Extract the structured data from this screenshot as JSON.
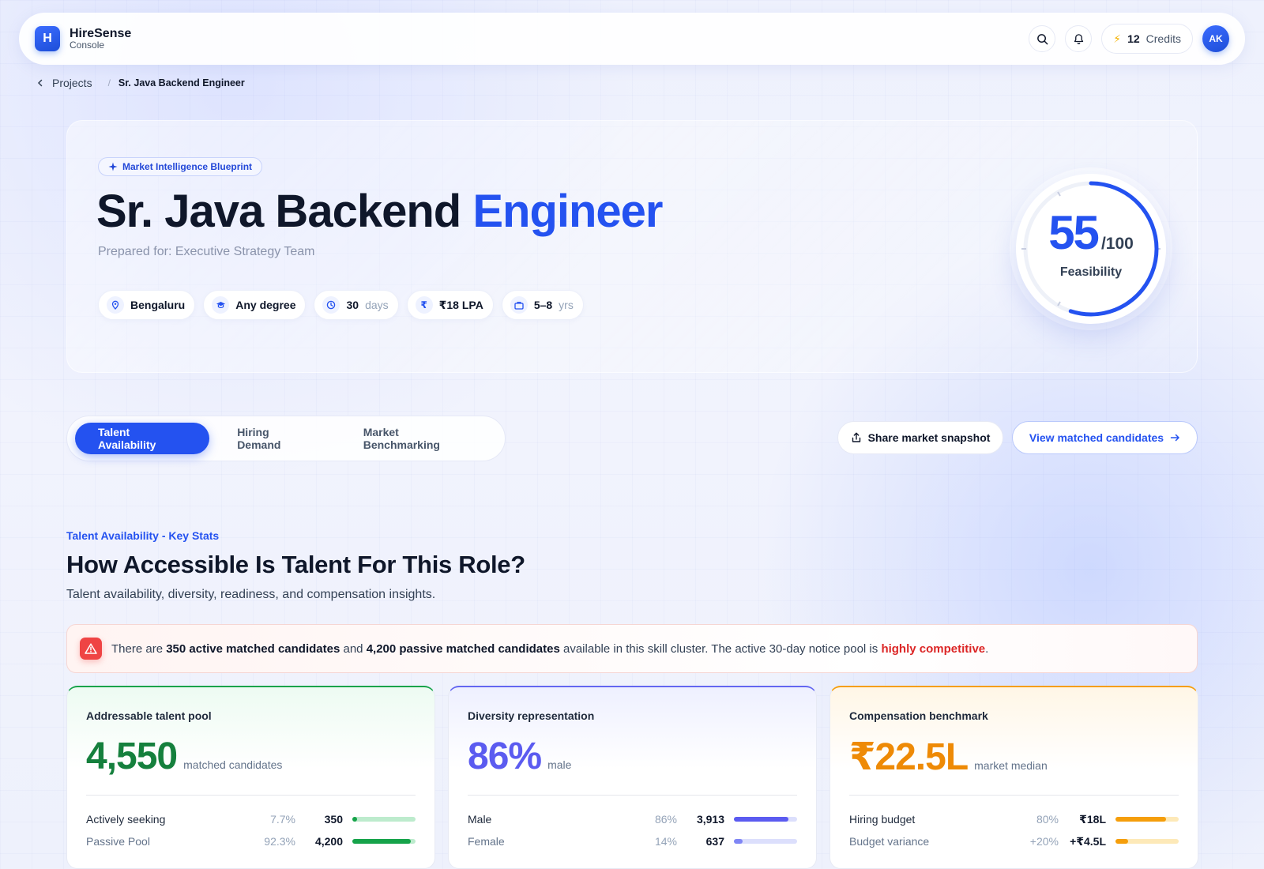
{
  "app": {
    "logo_letter": "H",
    "name": "HireSense",
    "subtitle": "Console",
    "credits_count": "12",
    "credits_label": "Credits",
    "avatar_initials": "AK",
    "icons": {
      "search": "search-icon",
      "bell": "bell-icon",
      "bolt": "bolt-icon"
    }
  },
  "breadcrumb": {
    "back_label": "Projects",
    "separator": "/",
    "current": "Sr. Java Backend Engineer"
  },
  "hero": {
    "badge": "Market Intelligence Blueprint",
    "title_main": "Sr. Java Backend",
    "title_accent": "Engineer",
    "prepared_for": "Prepared for: Executive Strategy Team",
    "chips": [
      {
        "icon": "location-pin-icon",
        "value": "Bengaluru",
        "suffix": ""
      },
      {
        "icon": "graduation-cap-icon",
        "value": "Any degree",
        "suffix": ""
      },
      {
        "icon": "clock-icon",
        "value": "30",
        "suffix": "days"
      },
      {
        "icon": "rupee-icon",
        "value": "₹18 LPA",
        "suffix": ""
      },
      {
        "icon": "briefcase-icon",
        "value": "5–8",
        "suffix": "yrs"
      }
    ],
    "feasibility": {
      "score": "55",
      "out_of": "/100",
      "label": "Feasibility",
      "fraction": 0.55
    }
  },
  "tabs": {
    "items": [
      "Talent Availability",
      "Hiring Demand",
      "Market Benchmarking"
    ],
    "active_index": 0
  },
  "actions": {
    "share": "Share market snapshot",
    "view": "View matched candidates"
  },
  "section": {
    "kicker": "Talent Availability - Key Stats",
    "title": "How Accessible Is Talent For This Role?",
    "subtitle": "Talent availability, diversity, readiness, and compensation insights."
  },
  "alert": {
    "t1": "There are ",
    "b1": "350 active matched candidates",
    "t2": " and ",
    "b2": "4,200 passive matched candidates",
    "t3": " available in this skill cluster. The active 30-day notice pool is ",
    "danger": "highly competitive",
    "t4": "."
  },
  "cards": [
    {
      "title": "Addressable talent pool",
      "value": "4,550",
      "unit": "matched candidates",
      "accent": "#16a34a",
      "rows": [
        {
          "label": "Actively seeking",
          "pct": "7.7%",
          "count": "350",
          "fill": 0.077
        },
        {
          "label": "Passive Pool",
          "pct": "92.3%",
          "count": "4,200",
          "fill": 0.923
        }
      ]
    },
    {
      "title": "Diversity representation",
      "value": "86%",
      "unit": "male",
      "accent": "#6366f1",
      "rows": [
        {
          "label": "Male",
          "pct": "86%",
          "count": "3,913",
          "fill": 0.86
        },
        {
          "label": "Female",
          "pct": "14%",
          "count": "637",
          "fill": 0.14
        }
      ]
    },
    {
      "title": "Compensation benchmark",
      "value": "₹22.5L",
      "unit": "market median",
      "accent": "#f59e0b",
      "rows": [
        {
          "label": "Hiring budget",
          "pct": "80%",
          "count": "₹18L",
          "fill": 0.8
        },
        {
          "label": "Budget variance",
          "pct": "+20%",
          "count": "+₹4.5L",
          "fill": 0.2
        }
      ]
    }
  ]
}
